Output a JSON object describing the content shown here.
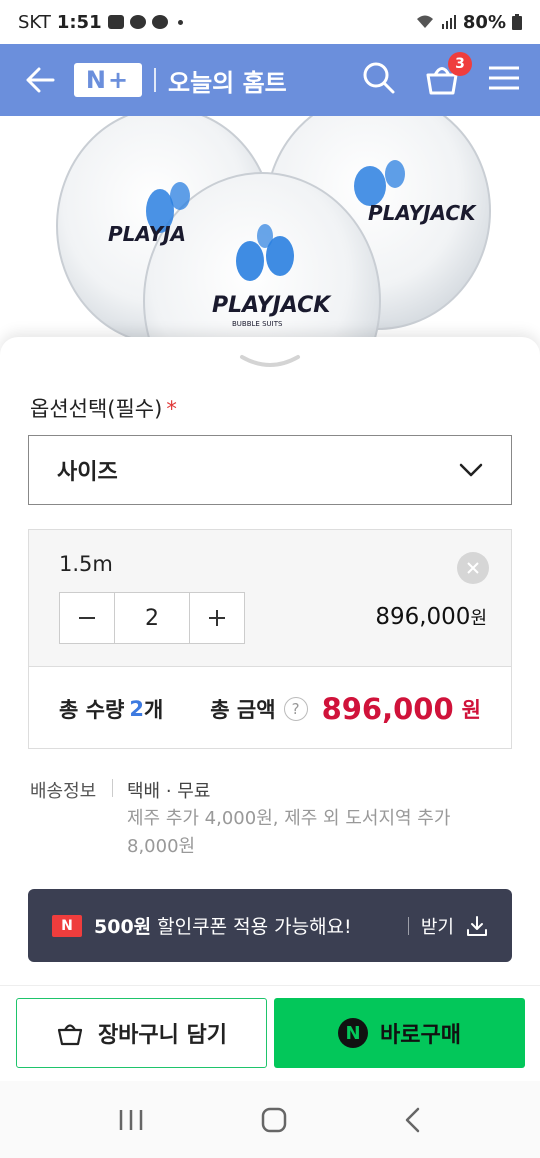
{
  "status_bar": {
    "carrier": "SKT",
    "time": "1:51",
    "battery": "80%"
  },
  "header": {
    "logo_text": "N+",
    "title": "오늘의 홈트",
    "cart_count": "3",
    "color": "#6b8fdc"
  },
  "product_image": {
    "brand_text": "PLAYJACK",
    "sub_text": "BUBBLE SUITS"
  },
  "option": {
    "label": "옵션선택(필수)",
    "required_mark": "*",
    "select_value": "사이즈"
  },
  "selected_item": {
    "name": "1.5m",
    "quantity": "2",
    "price": "896,000",
    "price_unit": "원"
  },
  "totals": {
    "quantity_label": "총 수량",
    "quantity_value": "2",
    "quantity_unit": "개",
    "amount_label": "총 금액",
    "help_icon": "?",
    "amount_value": "896,000",
    "amount_unit": "원",
    "amount_color": "#d0123a"
  },
  "shipping": {
    "label": "배송정보",
    "main": "택배 · 무료",
    "sub": "제주 추가 4,000원, 제주 외 도서지역 추가 8,000원"
  },
  "coupon": {
    "icon_text": "N",
    "amount": "500원",
    "text": "할인쿠폰 적용 가능해요!",
    "receive_label": "받기"
  },
  "actions": {
    "cart_label": "장바구니 담기",
    "buy_icon_text": "N",
    "buy_label": "바로구매",
    "buy_color": "#03c75a"
  }
}
